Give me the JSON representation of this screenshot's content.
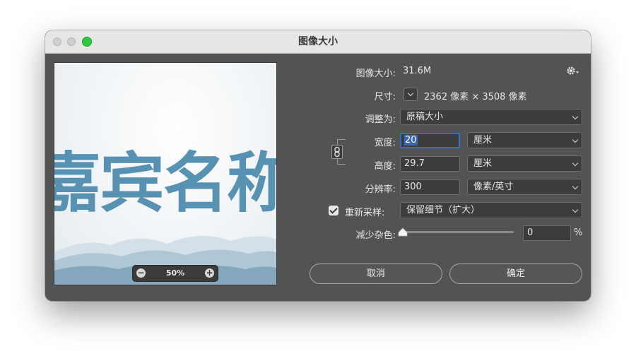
{
  "window": {
    "title": "图像大小"
  },
  "preview": {
    "image_text": "嘉宾名称",
    "zoom": "50%",
    "zoom_out": "−",
    "zoom_in": "+"
  },
  "form": {
    "image_size_label": "图像大小:",
    "image_size_value": "31.6M",
    "dimensions_label": "尺寸:",
    "dimensions_value": "2362 像素  ×  3508 像素",
    "fit_to_label": "调整为:",
    "fit_to_value": "原稿大小",
    "width_label": "宽度:",
    "width_value": "20",
    "width_unit": "厘米",
    "height_label": "高度:",
    "height_value": "29.7",
    "height_unit": "厘米",
    "resolution_label": "分辨率:",
    "resolution_value": "300",
    "resolution_unit": "像素/英寸",
    "resample_label": "重新采样:",
    "resample_checked": true,
    "resample_value": "保留细节（扩大）",
    "reduce_noise_label": "减少杂色:",
    "reduce_noise_value": "0",
    "reduce_noise_unit": "%",
    "reduce_noise_slider": 0
  },
  "buttons": {
    "cancel": "取消",
    "ok": "确定"
  },
  "icons": [
    "gear-icon",
    "link-icon",
    "chevron-down-icon",
    "checkmark-icon",
    "zoom-out-icon",
    "zoom-in-icon"
  ],
  "colors": {
    "dialog_bg": "#535353",
    "focus": "#2f6fd4",
    "selection": "#3b66b5",
    "image_text": "#5892b2"
  }
}
